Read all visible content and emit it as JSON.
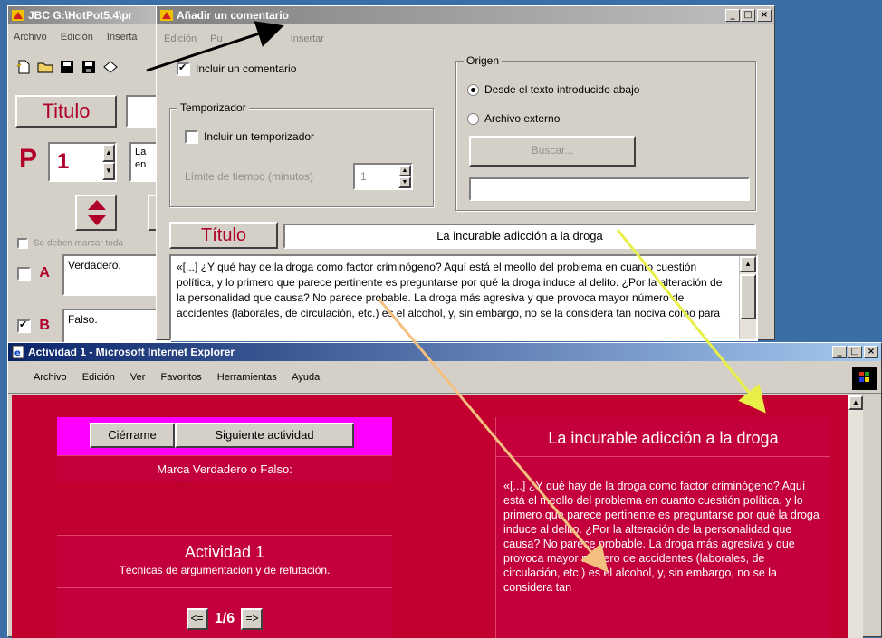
{
  "back_window": {
    "title": "JBC G:\\HotPot5.4\\pr",
    "menu": [
      "Archivo",
      "Edición",
      "Inserta"
    ],
    "titulo_label": "Titulo",
    "p_label": "P",
    "question_number": "1",
    "question_text_line1": "La",
    "question_text_line2": "en",
    "checkbox_all_label": "Se deben marcar toda",
    "answers": [
      {
        "letter": "A",
        "text": "Verdadero.",
        "checked": false
      },
      {
        "letter": "B",
        "text": "Falso.",
        "checked": true
      }
    ]
  },
  "dialog": {
    "title": "Añadir un comentario",
    "menu": [
      "Edición",
      "Pu",
      "Insertar"
    ],
    "include_comment_label": "Incluir un comentario",
    "timer_group_label": "Temporizador",
    "include_timer_label": "Incluir un temporizador",
    "time_limit_label": "Límite de tiempo (minutos)",
    "time_limit_value": "1",
    "origin_group_label": "Origen",
    "origin_text_label": "Desde el texto introducido abajo",
    "origin_file_label": "Archivo externo",
    "browse_button_label": "Buscar...",
    "file_path_value": "",
    "title_label": "Título",
    "title_value": "La incurable adicción a la droga",
    "comment_text": "«[...] ¿Y qué hay de la droga como factor criminógeno? Aquí está el meollo del problema en cuanto cuestión política, y lo primero que parece pertinente es preguntarse por qué la droga induce al delito. ¿Por la alteración de la personalidad que causa? No parece probable. La droga más agresiva y que provoca mayor número de accidentes (laborales, de circulación, etc.) es el alcohol, y, sin embargo, no se la considera tan nociva como para"
  },
  "ie": {
    "title": "Actividad 1 - Microsoft Internet Explorer",
    "menu": [
      "Archivo",
      "Edición",
      "Ver",
      "Favoritos",
      "Herramientas",
      "Ayuda"
    ],
    "close_button_label": "Ciérrame",
    "next_button_label": "Siguiente actividad",
    "instruction": "Marca Verdadero o Falso:",
    "activity_title": "Actividad 1",
    "activity_subtitle": "Técnicas de argumentación y de refutación.",
    "prev_label": "<=",
    "page_indicator": "1/6",
    "next_label": "=>",
    "reading_title": "La incurable adicción a la droga",
    "reading_text": "«[...] ¿Y qué hay de la droga como factor criminógeno? Aquí está el meollo del problema en cuanto cuestión política, y lo primero que parece pertinente es preguntarse por qué la droga induce al delito. ¿Por la alteración de la personalidad que causa? No parece probable. La droga más agresiva y que provoca mayor número de accidentes (laborales, de circulación, etc.) es el alcohol, y, sin embargo, no se la considera tan"
  },
  "colors": {
    "page_red": "#c4003c",
    "magenta_bar": "#ff00ff",
    "title_red": "#b0002a",
    "arrow_yellow": "#e8f048",
    "arrow_orange": "#f4c080"
  }
}
